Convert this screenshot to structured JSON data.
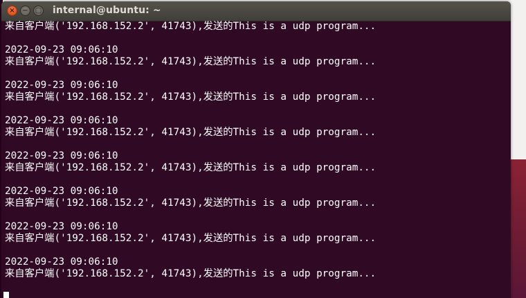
{
  "window": {
    "title": "internal@ubuntu: ~",
    "close_glyph": "×",
    "minimize_glyph": "−",
    "maximize_glyph": "□"
  },
  "colors": {
    "terminal_bg": "#300a24",
    "terminal_fg": "#ffffff",
    "close_button": "#e2531f",
    "titlebar": "#4a4843"
  },
  "icons": {
    "close": "close-icon",
    "minimize": "minimize-icon",
    "maximize": "maximize-icon"
  },
  "terminal": {
    "first_message": "来自客户端('192.168.152.2', 41743),发送的This is a udp program...",
    "entries": [
      {
        "timestamp": "2022-09-23 09:06:10",
        "message": "来自客户端('192.168.152.2', 41743),发送的This is a udp program..."
      },
      {
        "timestamp": "2022-09-23 09:06:10",
        "message": "来自客户端('192.168.152.2', 41743),发送的This is a udp program..."
      },
      {
        "timestamp": "2022-09-23 09:06:10",
        "message": "来自客户端('192.168.152.2', 41743),发送的This is a udp program..."
      },
      {
        "timestamp": "2022-09-23 09:06:10",
        "message": "来自客户端('192.168.152.2', 41743),发送的This is a udp program..."
      },
      {
        "timestamp": "2022-09-23 09:06:10",
        "message": "来自客户端('192.168.152.2', 41743),发送的This is a udp program..."
      },
      {
        "timestamp": "2022-09-23 09:06:10",
        "message": "来自客户端('192.168.152.2', 41743),发送的This is a udp program..."
      },
      {
        "timestamp": "2022-09-23 09:06:10",
        "message": "来自客户端('192.168.152.2', 41743),发送的This is a udp program..."
      }
    ]
  }
}
